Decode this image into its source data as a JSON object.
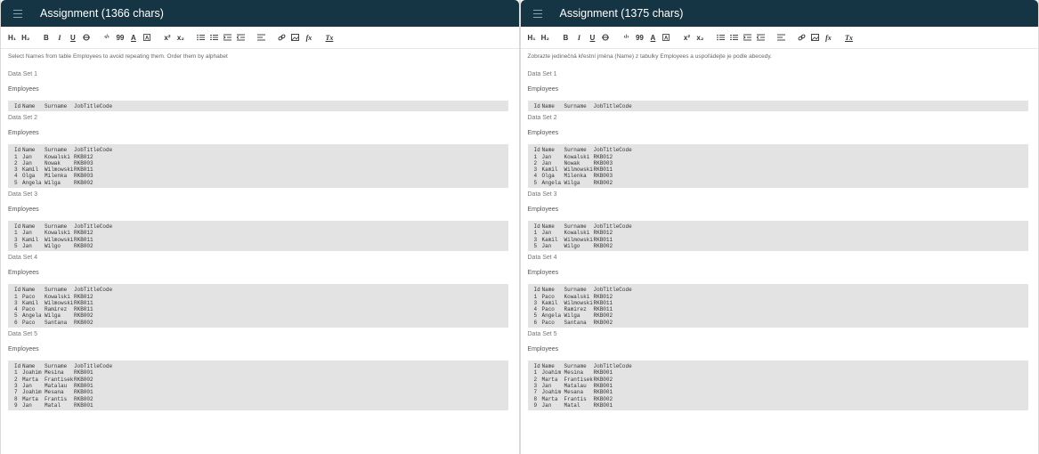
{
  "toolbar_icons": [
    "heading1",
    "heading2",
    "bold",
    "italic",
    "underline",
    "strikethrough",
    "code",
    "quote",
    "font-color",
    "highlight",
    "superscript",
    "subscript",
    "bullet-list",
    "numbered-list",
    "indent",
    "outdent",
    "align",
    "link",
    "image",
    "formula",
    "clear-format"
  ],
  "toolbar_labels": {
    "h1": "H₁",
    "h2": "H₂",
    "bold": "B",
    "italic": "I",
    "underline": "U",
    "code": "‹/›",
    "quote": "99",
    "sup": "x²",
    "sub": "x₂",
    "fx": "fx",
    "clear": "Tx"
  },
  "colors": {
    "titlebar": "#153444",
    "table_bg": "#e3e3e3"
  },
  "panels": [
    {
      "title": "Assignment (1366 chars)",
      "instruction": "Select Names from table Employees to avoid repeating them. Order them by alphabet",
      "datasets": [
        {
          "label": "Data Set 1",
          "table_name": "Employees",
          "header": [
            "Id",
            "Name",
            "Surname",
            "JobTitleCode"
          ],
          "rows": []
        },
        {
          "label": "Data Set 2",
          "table_name": "Employees",
          "header": [
            "Id",
            "Name",
            "Surname",
            "JobTitleCode"
          ],
          "rows": [
            [
              "1",
              "Jan",
              "Kowalski",
              "RKB012"
            ],
            [
              "2",
              "Jan",
              "Nowak",
              "RKB003"
            ],
            [
              "3",
              "Kamil",
              "Wilmowski",
              "RKB011"
            ],
            [
              "4",
              "Olga",
              "Milenka",
              "RKB003"
            ],
            [
              "5",
              "Angela",
              "Wilga",
              "RKB002"
            ]
          ]
        },
        {
          "label": "Data Set 3",
          "table_name": "Employees",
          "header": [
            "Id",
            "Name",
            "Surname",
            "JobTitleCode"
          ],
          "rows": [
            [
              "1",
              "Jan",
              "Kowalski",
              "RKB012"
            ],
            [
              "3",
              "Kamil",
              "Wilmowski",
              "RKB011"
            ],
            [
              "5",
              "Jan",
              "Wilgo",
              "RKB002"
            ]
          ]
        },
        {
          "label": "Data Set 4",
          "table_name": "Employees",
          "header": [
            "Id",
            "Name",
            "Surname",
            "JobTitleCode"
          ],
          "rows": [
            [
              "1",
              "Paco",
              "Kowalski",
              "RKB012"
            ],
            [
              "3",
              "Kamil",
              "Wilmowski",
              "RKB011"
            ],
            [
              "4",
              "Paco",
              "Ramirez",
              "RKB011"
            ],
            [
              "5",
              "Angela",
              "Wilga",
              "RKB002"
            ],
            [
              "6",
              "Paco",
              "Santana",
              "RKB002"
            ]
          ]
        },
        {
          "label": "Data Set 5",
          "table_name": "Employees",
          "header": [
            "Id",
            "Name",
            "Surname",
            "JobTitleCode"
          ],
          "rows": [
            [
              "1",
              "Joahim",
              "Mesina",
              "RKB001"
            ],
            [
              "2",
              "Marta",
              "Frantisek",
              "RKB002"
            ],
            [
              "3",
              "Jan",
              "Matalau",
              "RKB001"
            ],
            [
              "7",
              "Joahim",
              "Mesana",
              "RKB001"
            ],
            [
              "8",
              "Marta",
              "Frantis",
              "RKB002"
            ],
            [
              "9",
              "Jan",
              "Matal",
              "RKB001"
            ]
          ]
        }
      ]
    },
    {
      "title": "Assignment (1375 chars)",
      "instruction": "Zobrazte jedinečná křestní jména (Name) z tabulky Employees a uspořádejte je podle abecedy.",
      "datasets": [
        {
          "label": "Data Set 1",
          "table_name": "Employees",
          "header": [
            "Id",
            "Name",
            "Surname",
            "JobTitleCode"
          ],
          "rows": []
        },
        {
          "label": "Data Set 2",
          "table_name": "Employees",
          "header": [
            "Id",
            "Name",
            "Surname",
            "JobTitleCode"
          ],
          "rows": [
            [
              "1",
              "Jan",
              "Kowalski",
              "RKB012"
            ],
            [
              "2",
              "Jan",
              "Nowak",
              "RKB003"
            ],
            [
              "3",
              "Kamil",
              "Wilmowski",
              "RKB011"
            ],
            [
              "4",
              "Olga",
              "Milenka",
              "RKB003"
            ],
            [
              "5",
              "Angela",
              "Wilga",
              "RKB002"
            ]
          ]
        },
        {
          "label": "Data Set 3",
          "table_name": "Employees",
          "header": [
            "Id",
            "Name",
            "Surname",
            "JobTitleCode"
          ],
          "rows": [
            [
              "1",
              "Jan",
              "Kowalski",
              "RKB012"
            ],
            [
              "3",
              "Kamil",
              "Wilmowski",
              "RKB011"
            ],
            [
              "5",
              "Jan",
              "Wilgo",
              "RKB002"
            ]
          ]
        },
        {
          "label": "Data Set 4",
          "table_name": "Employees",
          "header": [
            "Id",
            "Name",
            "Surname",
            "JobTitleCode"
          ],
          "rows": [
            [
              "1",
              "Paco",
              "Kowalski",
              "RKB012"
            ],
            [
              "3",
              "Kamil",
              "Wilmowski",
              "RKB011"
            ],
            [
              "4",
              "Paco",
              "Ramirez",
              "RKB011"
            ],
            [
              "5",
              "Angela",
              "Wilga",
              "RKB002"
            ],
            [
              "6",
              "Paco",
              "Santana",
              "RKB002"
            ]
          ]
        },
        {
          "label": "Data Set 5",
          "table_name": "Employees",
          "header": [
            "Id",
            "Name",
            "Surname",
            "JobTitleCode"
          ],
          "rows": [
            [
              "1",
              "Joahim",
              "Mesina",
              "RKB001"
            ],
            [
              "2",
              "Marta",
              "Frantisek",
              "RKB002"
            ],
            [
              "3",
              "Jan",
              "Matalau",
              "RKB001"
            ],
            [
              "7",
              "Joahim",
              "Mesana",
              "RKB001"
            ],
            [
              "8",
              "Marta",
              "Frantis",
              "RKB002"
            ],
            [
              "9",
              "Jan",
              "Matal",
              "RKB001"
            ]
          ]
        }
      ]
    }
  ]
}
